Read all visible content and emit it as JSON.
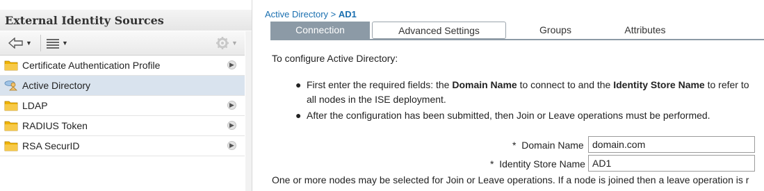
{
  "sidebar": {
    "title": "External Identity Sources",
    "items": [
      {
        "label": "Certificate Authentication Profile",
        "icon": "folder-icon",
        "has_chevron": true
      },
      {
        "label": "Active Directory",
        "icon": "active-directory-icon",
        "selected": true,
        "has_chevron": false
      },
      {
        "label": "LDAP",
        "icon": "folder-icon",
        "has_chevron": true
      },
      {
        "label": "RADIUS Token",
        "icon": "folder-icon",
        "has_chevron": true
      },
      {
        "label": "RSA SecurID",
        "icon": "folder-icon",
        "has_chevron": true
      }
    ]
  },
  "breadcrumb": {
    "parent": "Active Directory",
    "separator": ">",
    "current": "AD1"
  },
  "tabs": [
    {
      "label": "Connection",
      "active": true
    },
    {
      "label": "Advanced Settings"
    },
    {
      "label": "Groups"
    },
    {
      "label": "Attributes"
    }
  ],
  "content": {
    "intro": "To configure Active Directory:",
    "bullet1": {
      "prefix": "First enter the required fields: the ",
      "bold1": "Domain Name",
      "middle": " to connect to and the ",
      "bold2": "Identity Store Name",
      "suffix": " to refer to",
      "continuation": "all nodes in the ISE deployment."
    },
    "bullet2": "After the configuration has been submitted, then Join or Leave operations must be performed.",
    "fields": {
      "domain_name": {
        "label": "Domain Name",
        "value": "domain.com"
      },
      "identity_store_name": {
        "label": "Identity Store Name",
        "value": "AD1"
      },
      "required_marker": "*"
    },
    "note": "One or more nodes may be selected for Join or Leave operations. If a node is joined then a leave operation is r"
  },
  "colors": {
    "accent": "#1a6fb0",
    "tab_active": "#8c9aa6",
    "selected_row": "#d9e3ee",
    "folder": "#f0b400"
  }
}
